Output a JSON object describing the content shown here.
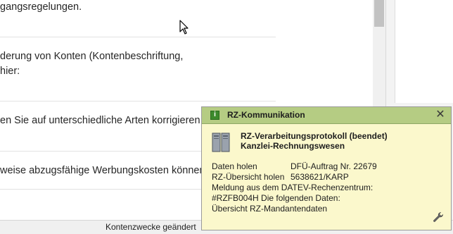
{
  "document": {
    "lines": [
      "gangsregelungen.",
      "derung von Konten (Kontenbeschriftung,",
      "hier:",
      "en Sie auf unterschiedliche Arten korrigieren",
      "weise abzugsfähige Werbungskosten können"
    ]
  },
  "statusbar": {
    "text": "Kontenzwecke geändert"
  },
  "notification": {
    "title": "RZ-Kommunikation",
    "protocol_title": "RZ-Verarbeitungsprotokoll  (beendet)",
    "protocol_subtitle": "Kanzlei-Rechnungswesen",
    "rows": [
      {
        "label": "Daten holen",
        "value": "DFÜ-Auftrag Nr. 22679"
      },
      {
        "label": "RZ-Übersicht holen",
        "value": "5638621/KARP"
      }
    ],
    "message_line1": "Meldung aus dem DATEV-Rechenzentrum:",
    "message_line2": "#RZFB004H Die folgenden Daten:",
    "message_line3": "Übersicht RZ-Mandantendaten"
  },
  "colors": {
    "popup_bg": "#fbf8cc",
    "popup_header": "#b5cc83",
    "statusbar": "#f0f0f0"
  },
  "icons": [
    "cursor-icon",
    "notification-icon",
    "close-icon",
    "server-icon",
    "wrench-icon"
  ]
}
